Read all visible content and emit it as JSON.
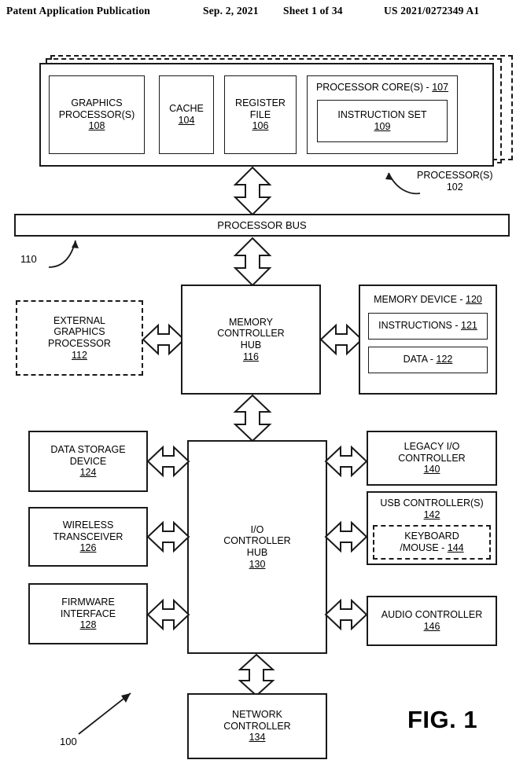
{
  "header": {
    "publication": "Patent Application Publication",
    "date": "Sep. 2, 2021",
    "sheet": "Sheet 1 of 34",
    "number": "US 2021/0272349 A1"
  },
  "figure": {
    "label": "FIG. 1",
    "system_ref": "100"
  },
  "processor_block": {
    "ref_label": "PROCESSOR(S)",
    "ref_number": "102",
    "graphics_processor": {
      "line1": "GRAPHICS",
      "line2": "PROCESSOR(S)",
      "ref": "108"
    },
    "cache": {
      "line1": "CACHE",
      "ref": "104"
    },
    "register_file": {
      "line1": "REGISTER",
      "line2": "FILE",
      "ref": "106"
    },
    "processor_core": {
      "title": "PROCESSOR CORE(S) - ",
      "ref": "107"
    },
    "instruction_set": {
      "line1": "INSTRUCTION SET",
      "ref": "109"
    }
  },
  "processor_bus": {
    "label": "PROCESSOR BUS",
    "ref": "110"
  },
  "external_graphics": {
    "line1": "EXTERNAL",
    "line2": "GRAPHICS",
    "line3": "PROCESSOR",
    "ref": "112"
  },
  "memory_controller_hub": {
    "line1": "MEMORY",
    "line2": "CONTROLLER",
    "line3": "HUB",
    "ref": "116"
  },
  "memory_device": {
    "title": "MEMORY DEVICE - ",
    "ref": "120",
    "instructions": {
      "label": "INSTRUCTIONS - ",
      "ref": "121"
    },
    "data": {
      "label": "DATA - ",
      "ref": "122"
    }
  },
  "io_controller_hub": {
    "line1": "I/O",
    "line2": "CONTROLLER",
    "line3": "HUB",
    "ref": "130"
  },
  "left_peripherals": [
    {
      "line1": "DATA STORAGE",
      "line2": "DEVICE",
      "ref": "124"
    },
    {
      "line1": "WIRELESS",
      "line2": "TRANSCEIVER",
      "ref": "126"
    },
    {
      "line1": "FIRMWARE",
      "line2": "INTERFACE",
      "ref": "128"
    }
  ],
  "right_peripherals": [
    {
      "line1": "LEGACY I/O",
      "line2": "CONTROLLER",
      "ref": "140"
    },
    {
      "line1": "USB CONTROLLER(S)",
      "ref": "142"
    },
    {
      "line1": "AUDIO CONTROLLER",
      "ref": "146"
    }
  ],
  "keyboard_mouse": {
    "line1": "KEYBOARD",
    "line2": "/MOUSE - ",
    "ref": "144"
  },
  "network_controller": {
    "line1": "NETWORK",
    "line2": "CONTROLLER",
    "ref": "134"
  },
  "colors": {
    "ink": "#1a1a1a",
    "paper": "#ffffff"
  }
}
